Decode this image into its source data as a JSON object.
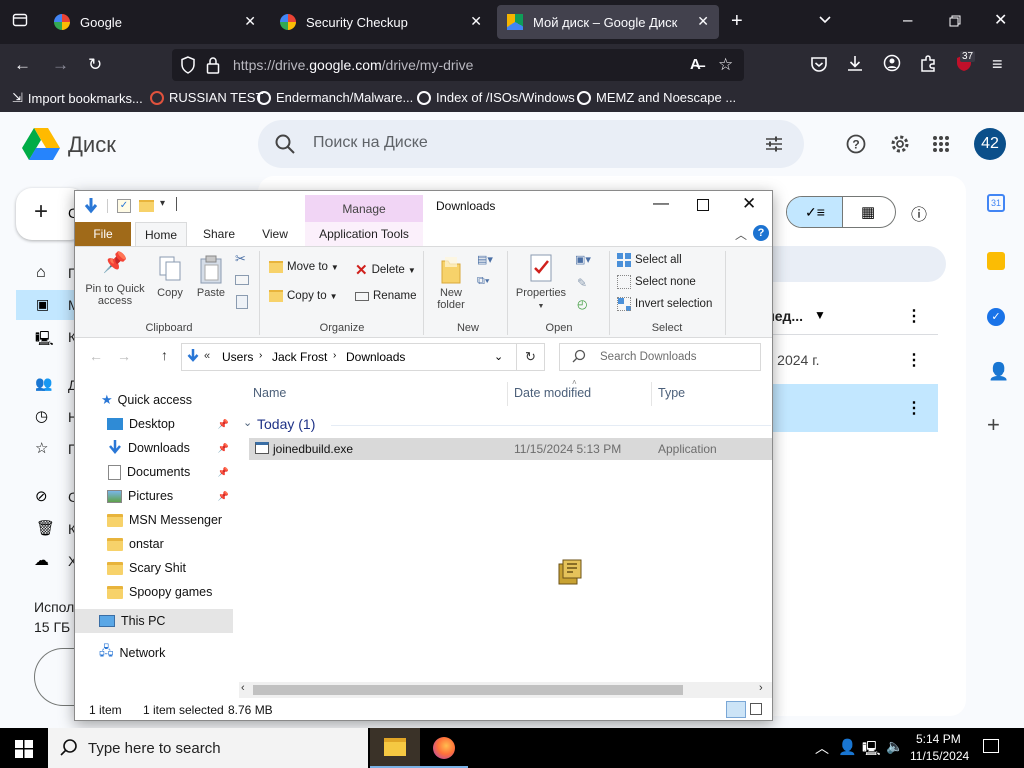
{
  "browser": {
    "tabs": [
      {
        "title": "Google",
        "active": false
      },
      {
        "title": "Security Checkup",
        "active": false
      },
      {
        "title": "Мой диск – Google Диск",
        "active": true
      }
    ],
    "url_prefix": "https://drive.",
    "url_domain": "google.com",
    "url_path": "/drive/my-drive",
    "extension_badge": "37",
    "bookmarks": [
      "Import bookmarks...",
      "RUSSIAN TEST",
      "Endermanch/Malware...",
      "Index of /ISOs/Windows",
      "MEMZ and Noescape ..."
    ]
  },
  "drive": {
    "app_name": "Диск",
    "search_placeholder": "Поиск на Диске",
    "avatar": "42",
    "new_label_partial": "С",
    "side_items": [
      "Г",
      "М",
      "К",
      "Д",
      "Н",
      "П",
      "С",
      "К",
      "Х"
    ],
    "storage_label_partial": "Испол",
    "storage_amount_partial": "15 ГБ",
    "col_header_partial": "лед...",
    "row_date_partial": "г. 2024 г."
  },
  "explorer": {
    "title": "Downloads",
    "manage_tab": "Manage",
    "ribbon_tabs": [
      "File",
      "Home",
      "Share",
      "View",
      "Application Tools"
    ],
    "clipboard": {
      "pin": "Pin to Quick access",
      "copy": "Copy",
      "paste": "Paste",
      "label": "Clipboard"
    },
    "organize": {
      "move_to": "Move to",
      "delete": "Delete",
      "copy_to": "Copy to",
      "rename": "Rename",
      "label": "Organize"
    },
    "new": {
      "new_folder": "New folder",
      "label": "New"
    },
    "open": {
      "properties": "Properties",
      "label": "Open"
    },
    "select": {
      "select_all": "Select all",
      "select_none": "Select none",
      "invert": "Invert selection",
      "label": "Select"
    },
    "breadcrumb": [
      "Users",
      "Jack Frost",
      "Downloads"
    ],
    "search_placeholder": "Search Downloads",
    "nav": {
      "quick_access": "Quick access",
      "pinned": [
        "Desktop",
        "Downloads",
        "Documents",
        "Pictures"
      ],
      "folders": [
        "MSN Messenger",
        "onstar",
        "Scary Shit",
        "Spoopy games"
      ],
      "this_pc": "This PC",
      "network": "Network"
    },
    "columns": [
      "Name",
      "Date modified",
      "Type"
    ],
    "group_header": "Today (1)",
    "files": [
      {
        "name": "joinedbuild.exe",
        "date": "11/15/2024 5:13 PM",
        "type": "Application"
      }
    ],
    "status": {
      "count": "1 item",
      "selected": "1 item selected",
      "size": "8.76 MB"
    }
  },
  "taskbar": {
    "search_placeholder": "Type here to search",
    "time": "5:14 PM",
    "date": "11/15/2024"
  }
}
